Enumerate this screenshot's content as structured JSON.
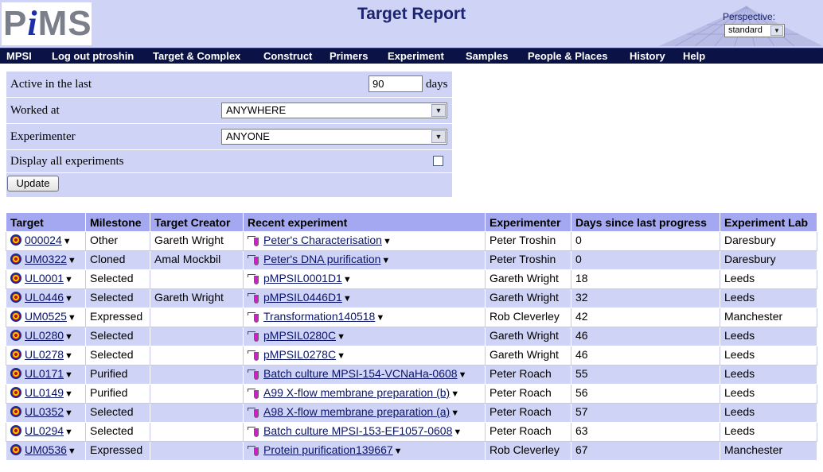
{
  "header": {
    "logo": {
      "p": "P",
      "i": "i",
      "ms": "MS"
    },
    "title": "Target Report",
    "perspective_label": "Perspective:",
    "perspective_value": "standard"
  },
  "nav": [
    "MPSI",
    "Log out ptroshin",
    "Target & Complex",
    "Construct",
    "Primers",
    "Experiment",
    "Samples",
    "People & Places",
    "History",
    "Help"
  ],
  "filter": {
    "active_label": "Active in the last",
    "active_value": "90",
    "active_unit": "days",
    "worked_label": "Worked at",
    "worked_value": "ANYWHERE",
    "experimenter_label": "Experimenter",
    "experimenter_value": "ANYONE",
    "display_all_label": "Display all experiments",
    "display_all_checked": false,
    "update_label": "Update"
  },
  "table": {
    "headers": [
      "Target",
      "Milestone",
      "Target Creator",
      "Recent experiment",
      "Experimenter",
      "Days since last progress",
      "Experiment Lab"
    ],
    "rows": [
      {
        "target": "000024",
        "milestone": "Other",
        "creator": "Gareth Wright",
        "experiment": "Peter's Characterisation",
        "experimenter": "Peter Troshin",
        "days": "0",
        "lab": "Daresbury"
      },
      {
        "target": "UM0322",
        "milestone": "Cloned",
        "creator": "Amal Mockbil",
        "experiment": "Peter's DNA purification",
        "experimenter": "Peter Troshin",
        "days": "0",
        "lab": "Daresbury"
      },
      {
        "target": "UL0001",
        "milestone": "Selected",
        "creator": "",
        "experiment": "pMPSIL0001D1",
        "experimenter": "Gareth Wright",
        "days": "18",
        "lab": "Leeds"
      },
      {
        "target": "UL0446",
        "milestone": "Selected",
        "creator": "Gareth Wright",
        "experiment": "pMPSIL0446D1",
        "experimenter": "Gareth Wright",
        "days": "32",
        "lab": "Leeds"
      },
      {
        "target": "UM0525",
        "milestone": "Expressed",
        "creator": "",
        "experiment": "Transformation140518",
        "experimenter": "Rob Cleverley",
        "days": "42",
        "lab": "Manchester"
      },
      {
        "target": "UL0280",
        "milestone": "Selected",
        "creator": "",
        "experiment": "pMPSIL0280C",
        "experimenter": "Gareth Wright",
        "days": "46",
        "lab": "Leeds"
      },
      {
        "target": "UL0278",
        "milestone": "Selected",
        "creator": "",
        "experiment": "pMPSIL0278C",
        "experimenter": "Gareth Wright",
        "days": "46",
        "lab": "Leeds"
      },
      {
        "target": "UL0171",
        "milestone": "Purified",
        "creator": "",
        "experiment": "Batch culture MPSI-154-VCNaHa-0608",
        "experimenter": "Peter Roach",
        "days": "55",
        "lab": "Leeds"
      },
      {
        "target": "UL0149",
        "milestone": "Purified",
        "creator": "",
        "experiment": "A99 X-flow membrane preparation (b)",
        "experimenter": "Peter Roach",
        "days": "56",
        "lab": "Leeds"
      },
      {
        "target": "UL0352",
        "milestone": "Selected",
        "creator": "",
        "experiment": "A98 X-flow membrane preparation (a)",
        "experimenter": "Peter Roach",
        "days": "57",
        "lab": "Leeds"
      },
      {
        "target": "UL0294",
        "milestone": "Selected",
        "creator": "",
        "experiment": "Batch culture MPSI-153-EF1057-0608",
        "experimenter": "Peter Roach",
        "days": "63",
        "lab": "Leeds"
      },
      {
        "target": "UM0536",
        "milestone": "Expressed",
        "creator": "",
        "experiment": "Protein purification139667",
        "experimenter": "Rob Cleverley",
        "days": "67",
        "lab": "Manchester"
      }
    ]
  },
  "icons": {
    "dropdown": "triangle-down",
    "target": "target-bullseye-icon",
    "experiment": "pipette-icon"
  },
  "colors": {
    "nav_bg": "#0b1346",
    "panel_bg": "#cfd3f5",
    "header_row": "#a3a8f0",
    "link": "#0a1468"
  }
}
